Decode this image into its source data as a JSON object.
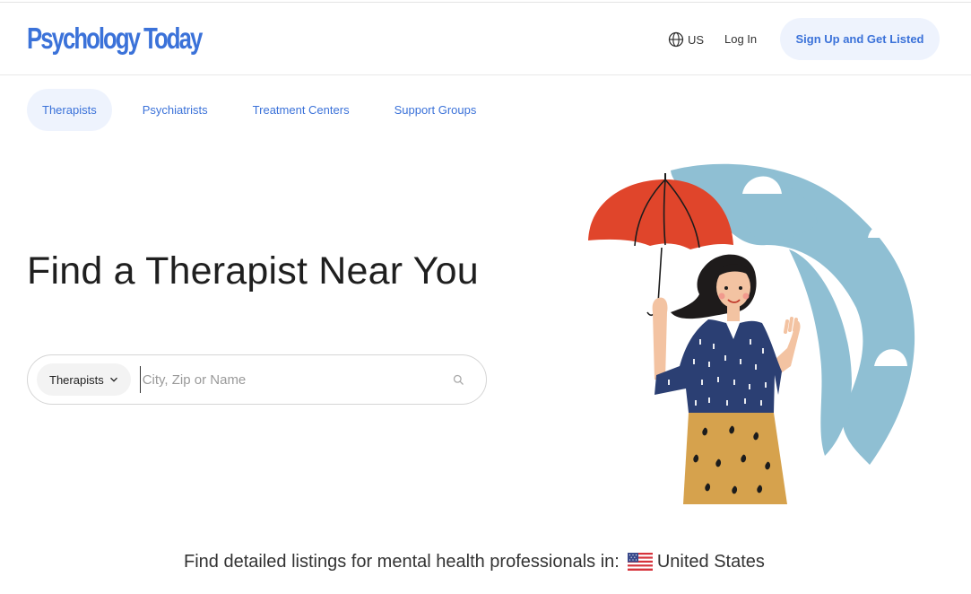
{
  "header": {
    "logo_text": "Psychology Today",
    "region_label": "US",
    "login_label": "Log In",
    "signup_label": "Sign Up and Get Listed"
  },
  "nav": {
    "tabs": [
      {
        "label": "Therapists",
        "active": true
      },
      {
        "label": "Psychiatrists",
        "active": false
      },
      {
        "label": "Treatment Centers",
        "active": false
      },
      {
        "label": "Support Groups",
        "active": false
      }
    ]
  },
  "hero": {
    "title": "Find a Therapist Near You",
    "search": {
      "type_label": "Therapists",
      "placeholder": "City, Zip or Name",
      "value": ""
    }
  },
  "footer": {
    "prefix": "Find detailed listings for mental health professionals in:",
    "country": "United States"
  },
  "icons": {
    "globe": "globe-icon",
    "chevron": "chevron-down-icon",
    "search": "search-icon",
    "flag": "us-flag-icon"
  },
  "colors": {
    "brand_blue": "#3b72d9",
    "pill_bg": "#eef3fd",
    "umbrella_red": "#e0452b",
    "blob_blue": "#8fbfd3",
    "shirt_navy": "#2b3f73",
    "skirt_mustard": "#d6a24d"
  }
}
